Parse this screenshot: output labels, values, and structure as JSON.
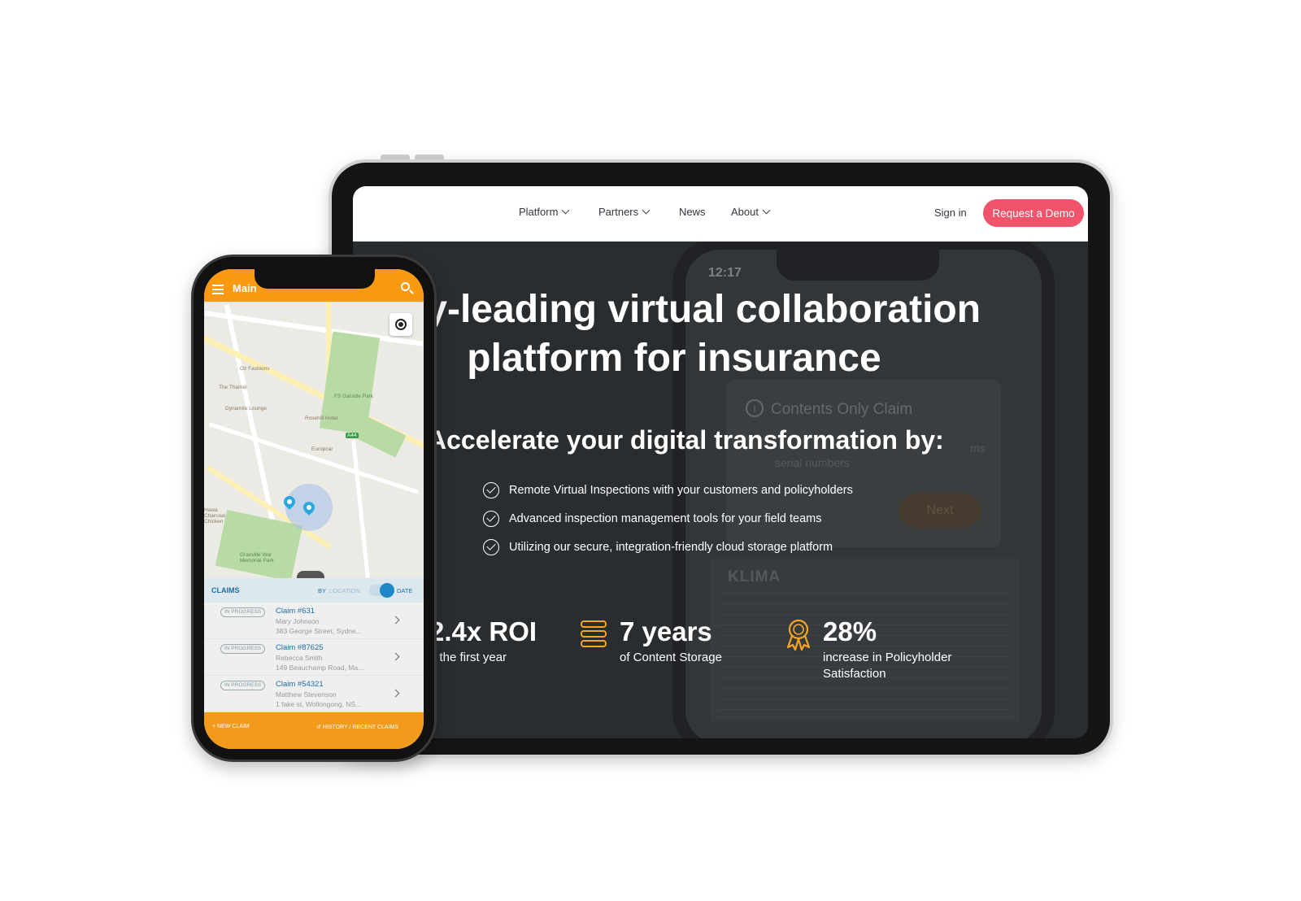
{
  "website": {
    "nav": {
      "items": [
        {
          "label": "Platform",
          "dropdown": true
        },
        {
          "label": "Partners",
          "dropdown": true
        },
        {
          "label": "News",
          "dropdown": false
        },
        {
          "label": "About",
          "dropdown": true
        }
      ],
      "sign_in": "Sign in",
      "cta": "Request a Demo"
    },
    "hero": {
      "title_line1": "stry-leading virtual collaboration",
      "title_line2": "platform for insurance",
      "subtitle": "Accelerate your digital transformation by:",
      "bullets": [
        "Remote Virtual Inspections with your customers and policyholders",
        "Advanced inspection management tools for your field teams",
        "Utilizing our secure, integration-friendly cloud storage platform"
      ]
    },
    "stats": [
      {
        "value": "2.4x ROI",
        "label": "n the first year",
        "icon": "none"
      },
      {
        "value": "7 years",
        "label": "of Content Storage",
        "icon": "database-icon"
      },
      {
        "value": "28%",
        "label_line1": "increase in Policyholder",
        "label_line2": "Satisfaction",
        "icon": "award-icon"
      }
    ],
    "background_phone": {
      "time": "12:17",
      "card_title": "Contents Only Claim",
      "card_text_line1": "ms",
      "card_text_line2": "serial numbers",
      "next_button": "Next",
      "label_brand": "KLIMA"
    },
    "colors": {
      "cta": "#f0536a",
      "hero_bg": "#2a2d30",
      "stat_icon": "#f5a623"
    }
  },
  "mobile_app": {
    "title": "Main",
    "map_labels": [
      "Oz Fashions",
      "The Thamel",
      "Dynamite Lounge",
      "Rosehill Hotel",
      "Europcar",
      "FS Garside Park",
      "Granville War Memorial Park",
      "A44",
      "Hawa Charcoal Chicken"
    ],
    "claims_header": "CLAIMS",
    "sort_by": "BY",
    "sort_location": "LOCATION",
    "sort_date": "DATE",
    "claims": [
      {
        "status": "IN PROGRESS",
        "id": "Claim #631",
        "name": "Mary Johnson",
        "address": "383 George Street, Sydne..."
      },
      {
        "status": "IN PROGRESS",
        "id": "Claim #87625",
        "name": "Rebecca Smith",
        "address": "149 Beauchamp Road, Ma..."
      },
      {
        "status": "IN PROGRESS",
        "id": "Claim #54321",
        "name": "Matthew Stevenson",
        "address": "1 fake st, Wollongong, NS..."
      }
    ],
    "bottom_bar": {
      "new_claim": "NEW CLAIM",
      "history": "HISTORY / RECENT CLAIMS"
    },
    "colors": {
      "appbar": "#fb9a10",
      "accent": "#1a6fa8"
    }
  }
}
